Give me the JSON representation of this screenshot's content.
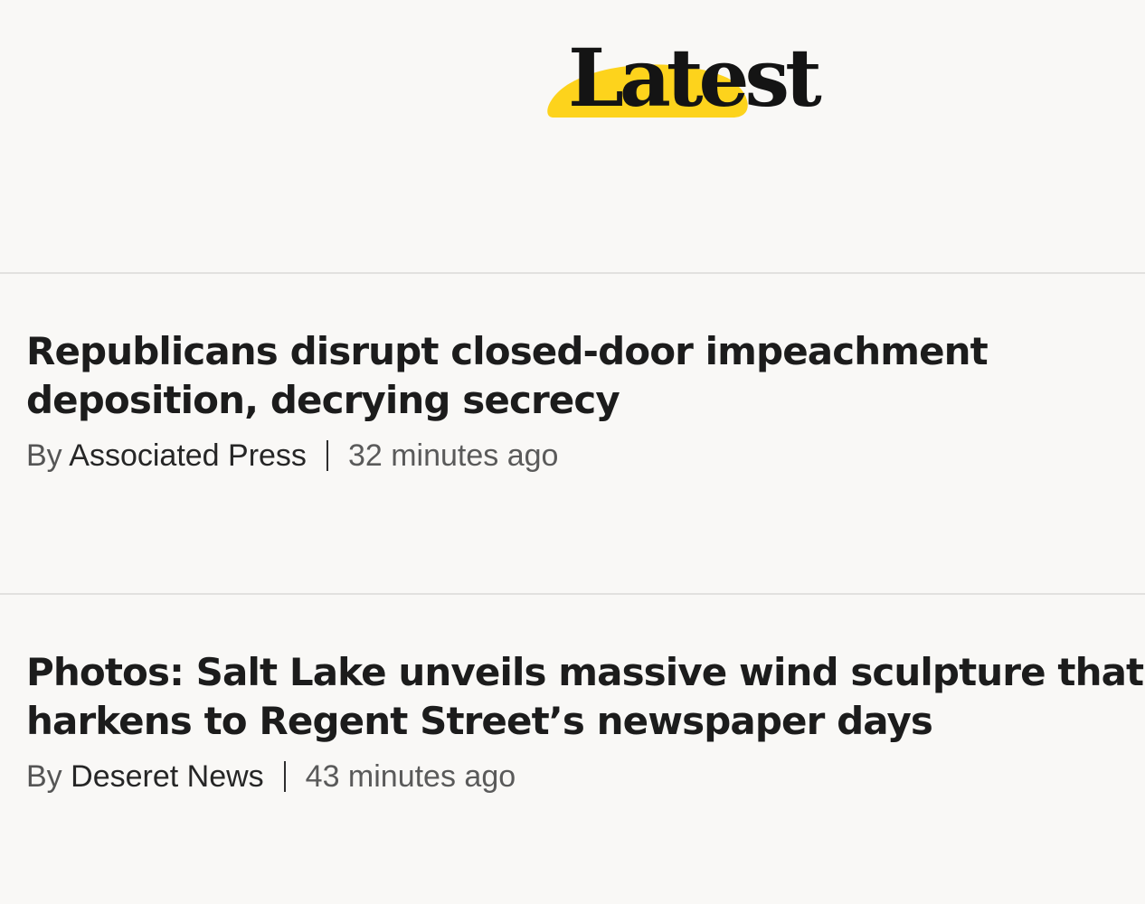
{
  "header": {
    "title": "Latest",
    "accent_color": "#fdd31c"
  },
  "stories": [
    {
      "headline": "Republicans disrupt closed-door impeachment deposition, decrying secrecy",
      "headline_line1": "Republicans disrupt closed-door impeachment",
      "headline_line2": "deposition, decrying secrecy",
      "by_prefix": "By",
      "author": "Associated Press",
      "time": "32 minutes ago"
    },
    {
      "headline": "Photos: Salt Lake unveils massive wind sculpture that harkens to Regent Street’s newspaper days",
      "headline_line1": "Photos: Salt Lake unveils massive wind sculpture that",
      "headline_line2": "harkens to Regent Street’s newspaper days",
      "by_prefix": "By",
      "author": "Deseret News",
      "time": "43 minutes ago"
    }
  ]
}
